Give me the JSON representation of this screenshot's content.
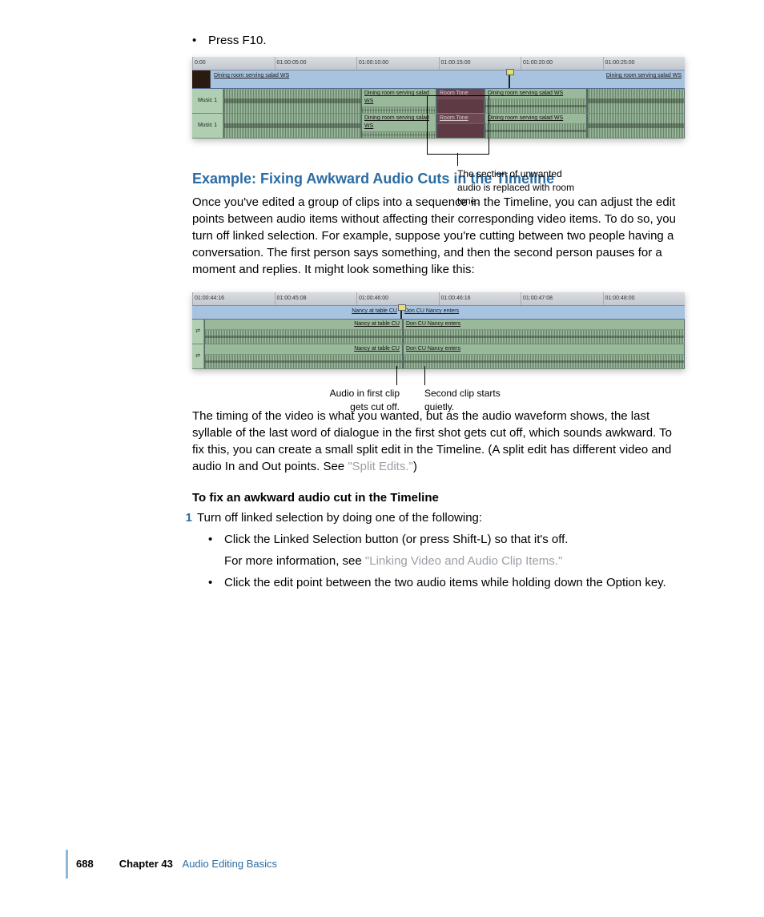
{
  "bullet1": "Press F10.",
  "figure1": {
    "ticks": [
      "0:00",
      "01:00:05:00",
      "01:00:10:00",
      "01:00:15:00",
      "01:00:20:00",
      "01:00:25:00"
    ],
    "video_clip1": "Dining room serving salad WS",
    "video_clip2": "Dining room serving salad WS",
    "audio_track_label": "Music 1",
    "audio_clips": {
      "a": "Dining room serving salad WS",
      "b": "Room Tone",
      "c": "Dining room serving salad WS"
    },
    "callout": "The section of unwanted audio is replaced with room tone."
  },
  "heading": "Example: Fixing Awkward Audio Cuts in the Timeline",
  "para1": "Once you've edited a group of clips into a sequence in the Timeline, you can adjust the edit points between audio items without affecting their corresponding video items. To do so, you turn off linked selection. For example, suppose you're cutting between two people having a conversation. The first person says something, and then the second person pauses for a moment and replies. It might look something like this:",
  "figure2": {
    "ticks": [
      "01:00:44:16",
      "01:00:45:08",
      "01:00:46:00",
      "01:00:46:16",
      "01:00:47:08",
      "01:00:48:00"
    ],
    "video_clip1": "Nancy at table CU",
    "video_clip2": "Don CU Nancy enters",
    "callout_left": "Audio in first clip gets cut off.",
    "callout_right": "Second clip starts quietly."
  },
  "para2_a": "The timing of the video is what you wanted, but as the audio waveform shows, the last syllable of the last word of dialogue in the first shot gets cut off, which sounds awkward. To fix this, you can create a small split edit in the Timeline. (A split edit has different video and audio In and Out points. See ",
  "para2_link": "\"Split Edits.\"",
  "para2_b": ")",
  "sub_heading": "To fix an awkward audio cut in the Timeline",
  "step1": "Turn off linked selection by doing one of the following:",
  "sub_bullet1": "Click the Linked Selection button (or press Shift-L) so that it's off.",
  "sub_info_a": "For more information, see ",
  "sub_info_link": "\"Linking Video and Audio Clip Items.\"",
  "sub_bullet2": "Click the edit point between the two audio items while holding down the Option key.",
  "footer": {
    "page": "688",
    "chapter_label": "Chapter 43",
    "chapter_title": "Audio Editing Basics"
  }
}
